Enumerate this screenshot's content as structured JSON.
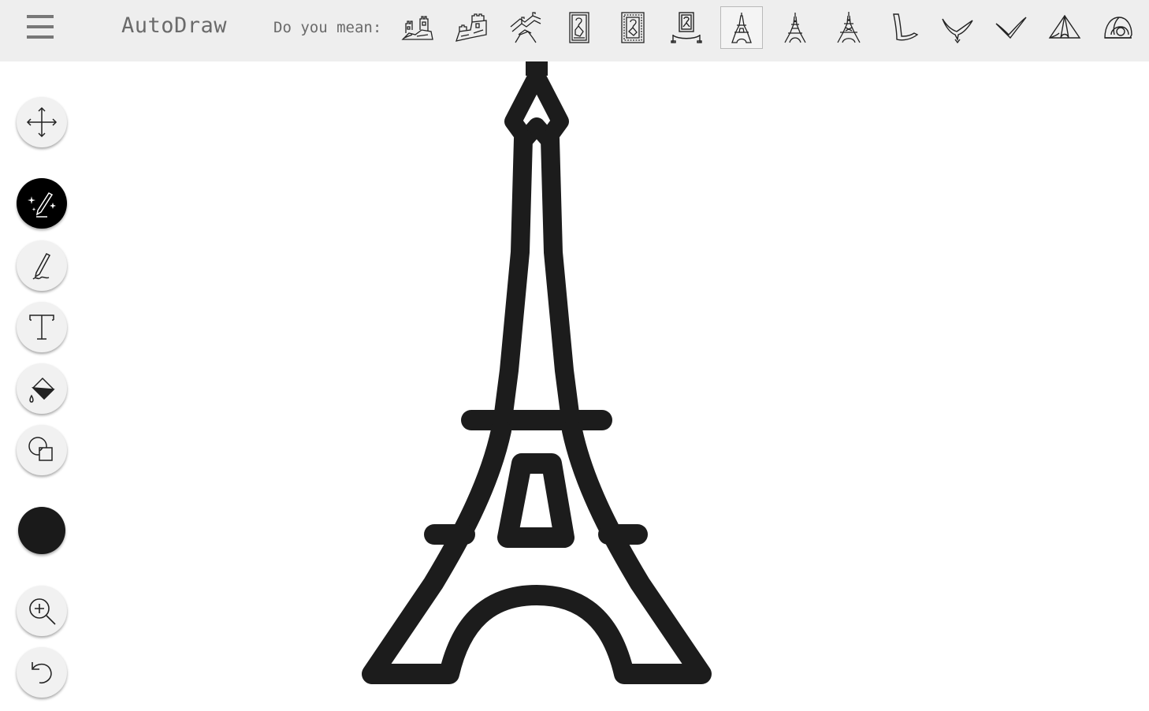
{
  "app": {
    "title": "AutoDraw"
  },
  "suggestions": {
    "prompt": "Do you mean:",
    "selected_index": 6,
    "items": [
      {
        "icon": "great-wall-icon"
      },
      {
        "icon": "great-wall-icon"
      },
      {
        "icon": "great-wall-icon"
      },
      {
        "icon": "framed-painting-icon"
      },
      {
        "icon": "framed-painting-icon"
      },
      {
        "icon": "museum-painting-icon"
      },
      {
        "icon": "eiffel-tower-icon"
      },
      {
        "icon": "eiffel-tower-icon"
      },
      {
        "icon": "eiffel-tower-icon"
      },
      {
        "icon": "boomerang-icon"
      },
      {
        "icon": "bird-icon"
      },
      {
        "icon": "bird-icon"
      },
      {
        "icon": "tent-icon"
      },
      {
        "icon": "helmet-icon"
      }
    ]
  },
  "tools": [
    {
      "icon": "move-icon",
      "active": false
    },
    {
      "icon": "autodraw-icon",
      "active": true
    },
    {
      "icon": "pencil-icon",
      "active": false
    },
    {
      "icon": "text-icon",
      "active": false
    },
    {
      "icon": "fill-icon",
      "active": false
    },
    {
      "icon": "shapes-icon",
      "active": false
    },
    {
      "icon": "zoom-in-icon",
      "active": false
    },
    {
      "icon": "undo-icon",
      "active": false
    }
  ],
  "colors": {
    "current": "#1a1a1a",
    "topbar": "#eeeeee",
    "stroke": "#1c1c1c"
  },
  "canvas": {
    "drawing_icon": "eiffel-tower-icon"
  }
}
